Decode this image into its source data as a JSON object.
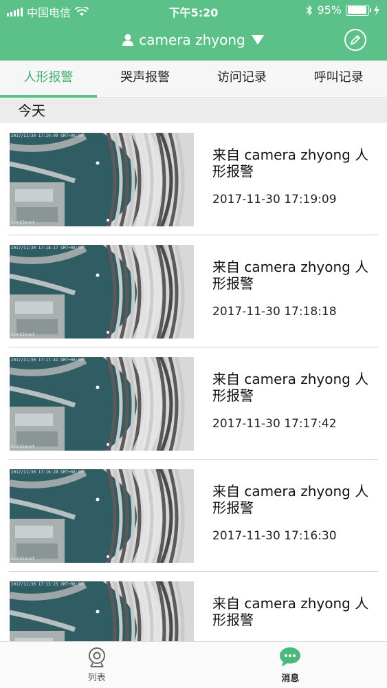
{
  "status_bar": {
    "carrier": "中国电信",
    "time": "下午5:20",
    "battery": "95%",
    "battery_level": 0.95
  },
  "header": {
    "title": "camera zhyong",
    "user_icon": "user-icon",
    "dropdown_icon": "triangle-down-icon",
    "edit_icon": "pencil-icon"
  },
  "tabs": [
    {
      "label": "人形报警",
      "active": true
    },
    {
      "label": "哭声报警",
      "active": false
    },
    {
      "label": "访问记录",
      "active": false
    },
    {
      "label": "呼叫记录",
      "active": false
    }
  ],
  "section_title": "今天",
  "messages": [
    {
      "text": "来自 camera zhyong 人形报警",
      "time": "2017-11-30 17:19:09",
      "overlay": "2017/11/30 17:19:09 GMT+08:00",
      "watermark": "eLinkSmart"
    },
    {
      "text": "来自 camera zhyong 人形报警",
      "time": "2017-11-30 17:18:18",
      "overlay": "2017/11/30 17:18:17 GMT+08:00",
      "watermark": "eLinkSmart"
    },
    {
      "text": "来自 camera zhyong 人形报警",
      "time": "2017-11-30 17:17:42",
      "overlay": "2017/11/30 17:17:41 GMT+08:00",
      "watermark": "eLinkSmart"
    },
    {
      "text": "来自 camera zhyong 人形报警",
      "time": "2017-11-30 17:16:30",
      "overlay": "2017/11/30 17:16:28 GMT+08:00",
      "watermark": "eLinkSmart"
    },
    {
      "text": "来自 camera zhyong 人形报警",
      "time": "",
      "overlay": "2017/11/30 17:13:25 GMT+08:00",
      "watermark": ""
    }
  ],
  "bottom_nav": [
    {
      "label": "列表",
      "icon": "camera-list-icon",
      "active": false
    },
    {
      "label": "消息",
      "icon": "chat-bubble-icon",
      "active": true
    }
  ],
  "colors": {
    "brand": "#5cc089",
    "active_tab": "#3fae6e"
  }
}
